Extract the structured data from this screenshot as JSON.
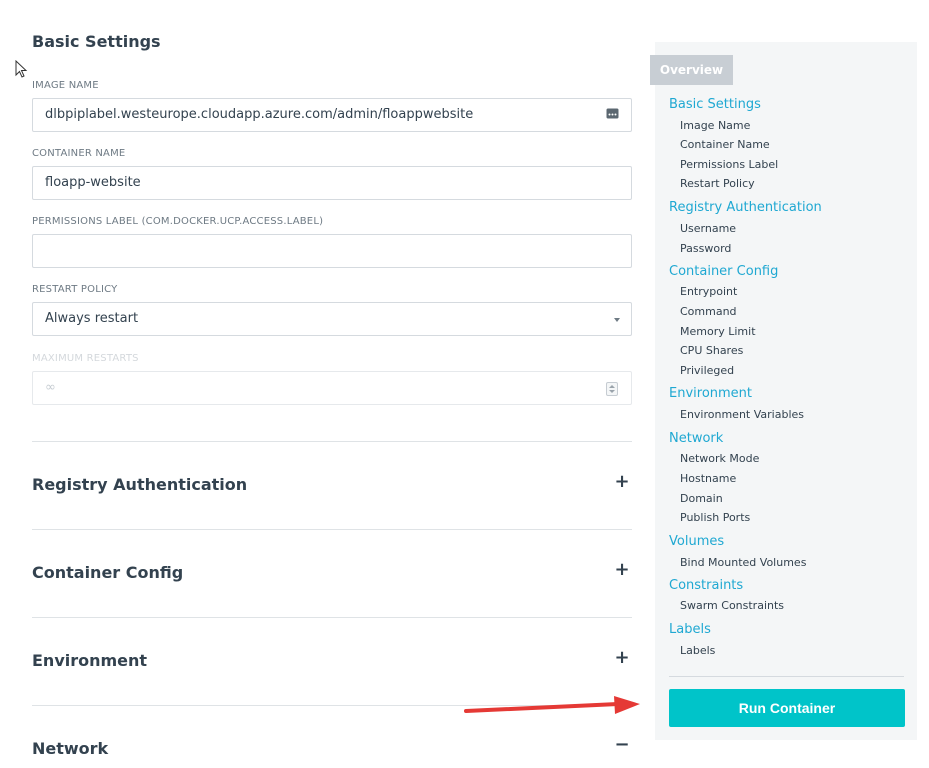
{
  "basic_settings": {
    "title": "Basic Settings",
    "image_name": {
      "label": "IMAGE NAME",
      "value": "dlbpiplabel.westeurope.cloudapp.azure.com/admin/floappwebsite",
      "icon": "more-dots-icon"
    },
    "container_name": {
      "label": "CONTAINER NAME",
      "value": "floapp-website"
    },
    "permissions_label": {
      "label": "PERMISSIONS LABEL (COM.DOCKER.UCP.ACCESS.LABEL)",
      "value": ""
    },
    "restart_policy": {
      "label": "RESTART POLICY",
      "value": "Always restart",
      "icon": "chevron-down-icon"
    },
    "maximum_restarts": {
      "label": "MAXIMUM RESTARTS",
      "placeholder": "∞",
      "icon": "spinner-icon"
    }
  },
  "collapsible_sections": [
    {
      "title": "Registry Authentication",
      "toggle": "+"
    },
    {
      "title": "Container Config",
      "toggle": "+"
    },
    {
      "title": "Environment",
      "toggle": "+"
    },
    {
      "title": "Network",
      "toggle": "−"
    }
  ],
  "sidebar": {
    "overview_tab": "Overview",
    "toc": [
      {
        "label": "Basic Settings",
        "items": [
          "Image Name",
          "Container Name",
          "Permissions Label",
          "Restart Policy"
        ]
      },
      {
        "label": "Registry Authentication",
        "items": [
          "Username",
          "Password"
        ]
      },
      {
        "label": "Container Config",
        "items": [
          "Entrypoint",
          "Command",
          "Memory Limit",
          "CPU Shares",
          "Privileged"
        ]
      },
      {
        "label": "Environment",
        "items": [
          "Environment Variables"
        ]
      },
      {
        "label": "Network",
        "items": [
          "Network Mode",
          "Hostname",
          "Domain",
          "Publish Ports"
        ]
      },
      {
        "label": "Volumes",
        "items": [
          "Bind Mounted Volumes"
        ]
      },
      {
        "label": "Constraints",
        "items": [
          "Swarm Constraints"
        ]
      },
      {
        "label": "Labels",
        "items": [
          "Labels"
        ]
      }
    ],
    "run_button": "Run Container"
  },
  "colors": {
    "accent": "#1fa8d2",
    "run_button": "#00c4c9",
    "annotation_arrow": "#e53935"
  }
}
